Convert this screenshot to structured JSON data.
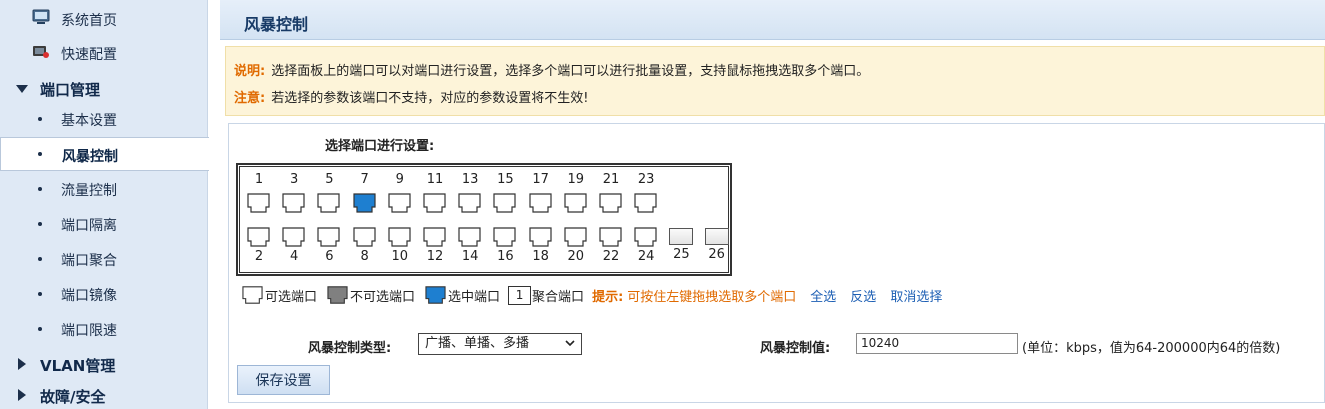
{
  "sidebar": {
    "home": "系统首页",
    "quick": "快速配置",
    "port_mgmt": "端口管理",
    "subitems": [
      "基本设置",
      "风暴控制",
      "流量控制",
      "端口隔离",
      "端口聚合",
      "端口镜像",
      "端口限速"
    ],
    "vlan": "VLAN管理",
    "fault": "故障/安全"
  },
  "page": {
    "title": "风暴控制"
  },
  "notice": {
    "desc_key": "说明:",
    "desc_text": "选择面板上的端口可以对端口进行设置，选择多个端口可以进行批量设置，支持鼠标拖拽选取多个端口。",
    "note_key": "注意:",
    "note_text": "若选择的参数该端口不支持，对应的参数设置将不生效!"
  },
  "ports": {
    "select_title": "选择端口进行设置:",
    "odd": [
      "1",
      "3",
      "5",
      "7",
      "9",
      "11",
      "13",
      "15",
      "17",
      "19",
      "21",
      "23"
    ],
    "even": [
      "2",
      "4",
      "6",
      "8",
      "10",
      "12",
      "14",
      "16",
      "18",
      "20",
      "22",
      "24"
    ],
    "sfp": [
      "25",
      "26"
    ],
    "selected": [
      "7"
    ]
  },
  "legend": {
    "selectable": "可选端口",
    "unselectable": "不可选端口",
    "selected": "选中端口",
    "agg_num": "1",
    "aggregated": "聚合端口",
    "tip_key": "提示:",
    "tip_text": "可按住左键拖拽选取多个端口",
    "select_all": "全选",
    "invert": "反选",
    "cancel": "取消选择"
  },
  "form": {
    "type_label": "风暴控制类型:",
    "type_value": "广播、单播、多播",
    "value_label": "风暴控制值:",
    "value": "10240",
    "value_hint": "(单位：kbps，值为64-200000内64的倍数)",
    "save": "保存设置"
  },
  "colors": {
    "accent": "#e06a00",
    "link": "#1d5fb4",
    "selected_port": "#1e7fd0",
    "unselectable_port": "#808080"
  }
}
